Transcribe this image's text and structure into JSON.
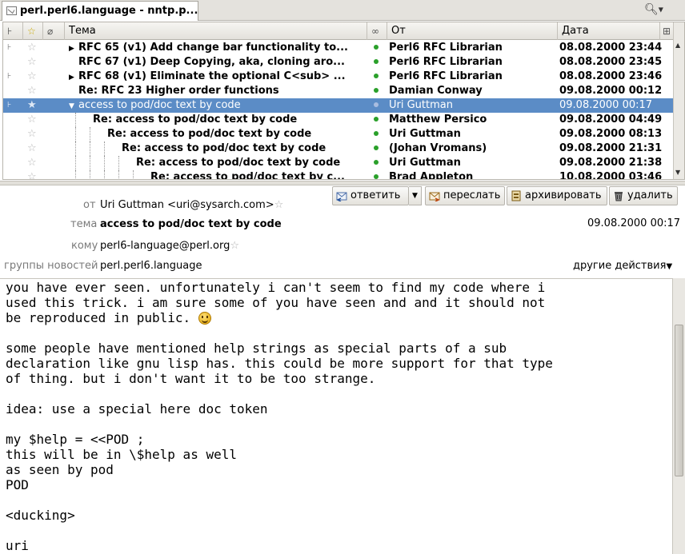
{
  "tab": {
    "title": "perl.perl6.language - nntp.p..."
  },
  "columns": {
    "subject": "Тема",
    "from": "От",
    "date": "Дата"
  },
  "messages": [
    {
      "twisty": "▶",
      "subject": "RFC 65 (v1) Add change bar functionality to...",
      "from": "Perl6 RFC Librarian",
      "date": "08.08.2000 23:44",
      "level": 0,
      "threadmark": "⊦"
    },
    {
      "twisty": "",
      "subject": "RFC 67 (v1) Deep Copying, aka, cloning aro...",
      "from": "Perl6 RFC Librarian",
      "date": "08.08.2000 23:45",
      "level": 0,
      "threadmark": ""
    },
    {
      "twisty": "▶",
      "subject": "RFC 68 (v1) Eliminate the optional C<sub> ...",
      "from": "Perl6 RFC Librarian",
      "date": "08.08.2000 23:46",
      "level": 0,
      "threadmark": "⊦"
    },
    {
      "twisty": "",
      "subject": "Re: RFC 23 Higher order functions",
      "from": "Damian Conway",
      "date": "09.08.2000 00:12",
      "level": 0,
      "threadmark": ""
    },
    {
      "twisty": "▼",
      "subject": "access to pod/doc text by code",
      "from": "Uri Guttman",
      "date": "09.08.2000 00:17",
      "level": 0,
      "threadmark": "⊦",
      "selected": true
    },
    {
      "twisty": "",
      "subject": "Re: access to pod/doc text by code",
      "from": "Matthew Persico",
      "date": "09.08.2000 04:49",
      "level": 1,
      "threadmark": ""
    },
    {
      "twisty": "",
      "subject": "Re: access to pod/doc text by code",
      "from": "Uri Guttman",
      "date": "09.08.2000 08:13",
      "level": 2,
      "threadmark": ""
    },
    {
      "twisty": "",
      "subject": "Re: access to pod/doc text by code",
      "from": "(Johan Vromans)",
      "date": "09.08.2000 21:31",
      "level": 3,
      "threadmark": ""
    },
    {
      "twisty": "",
      "subject": "Re: access to pod/doc text by code",
      "from": "Uri Guttman",
      "date": "09.08.2000 21:38",
      "level": 4,
      "threadmark": ""
    },
    {
      "twisty": "",
      "subject": "Re: access to pod/doc text by c...",
      "from": "Brad Appleton",
      "date": "10.08.2000 03:46",
      "level": 5,
      "threadmark": ""
    }
  ],
  "header": {
    "from_label": "от",
    "from_value": "Uri Guttman <uri@sysarch.com>",
    "subject_label": "тема",
    "subject_value": "access to pod/doc text by code",
    "date_value": "09.08.2000 00:17",
    "to_label": "кому",
    "to_value": "perl6-language@perl.org",
    "groups_label": "группы новостей",
    "groups_value": "perl.perl6.language",
    "other_actions": "другие действия"
  },
  "actions": {
    "reply": "ответить",
    "forward": "переслать",
    "archive": "архивировать",
    "delete": "удалить"
  },
  "body": {
    "line1": "you have ever seen. unfortunately i can't seem to find my code where i",
    "line2": "used this trick. i am sure some of you have seen and and it should not",
    "line3": "be reproduced in public. ",
    "line4": "",
    "line5": "some people have mentioned help strings as special parts of a sub",
    "line6": "declaration like gnu lisp has. this could be more support for that type",
    "line7": "of thing. but i don't want it to be too strange.",
    "line8": "",
    "line9": "idea: use a special here doc token",
    "line10": "",
    "line11": "my $help = <<POD ;",
    "line12": "this will be in \\$help as well",
    "line13": "as seen by pod",
    "line14": "POD",
    "line15": "",
    "line16": "<ducking>",
    "line17": "",
    "line18": "uri"
  }
}
